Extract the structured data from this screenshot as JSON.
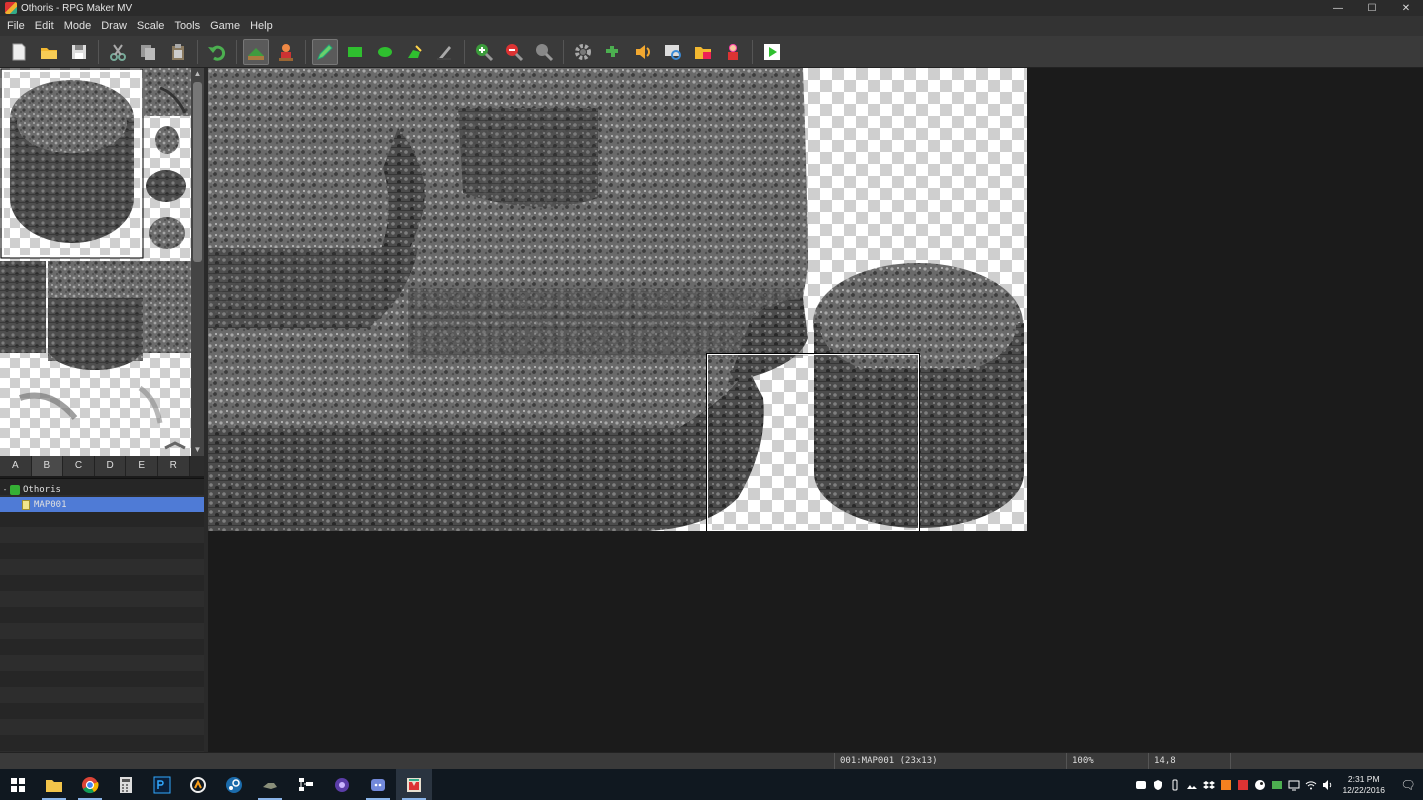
{
  "window": {
    "title": "Othoris - RPG Maker MV",
    "minimize": "—",
    "maximize": "☐",
    "close": "✕"
  },
  "menubar": {
    "items": [
      "File",
      "Edit",
      "Mode",
      "Draw",
      "Scale",
      "Tools",
      "Game",
      "Help"
    ]
  },
  "toolbar": {
    "buttons": [
      "new-project-icon",
      "open-project-icon",
      "save-project-icon",
      "cut-icon",
      "copy-icon",
      "paste-icon",
      "undo-icon",
      "map-mode-icon",
      "event-mode-icon",
      "pencil-icon",
      "rectangle-icon",
      "ellipse-icon",
      "flood-fill-icon",
      "shadow-pen-icon",
      "zoom-in-icon",
      "zoom-out-icon",
      "actual-size-icon",
      "database-icon",
      "plugin-manager-icon",
      "sound-test-icon",
      "event-searcher-icon",
      "resource-manager-icon",
      "character-generator-icon",
      "playtest-icon"
    ]
  },
  "tileset": {
    "tabs": [
      "A",
      "B",
      "C",
      "D",
      "E",
      "R"
    ],
    "active_tab": "B"
  },
  "map_tree": {
    "project": {
      "toggle": "-",
      "name": "Othoris"
    },
    "maps": [
      {
        "name": "MAP001"
      }
    ]
  },
  "statusbar": {
    "map": "001:MAP001 (23x13)",
    "zoom": "100%",
    "coords": "14,8"
  },
  "taskbar": {
    "apps": [
      "windows-start-icon",
      "file-explorer-icon",
      "chrome-icon",
      "calculator-icon",
      "photoshop-icon",
      "overwatch-icon",
      "steam-icon",
      "game-icon",
      "task-manager-icon",
      "app-icon",
      "discord-icon",
      "rpg-maker-icon"
    ],
    "clock_time": "2:31 PM",
    "clock_date": "12/22/2016",
    "notification": "🗨"
  },
  "colors": {
    "selection": "#4f7bd6",
    "background": "#1b1b1b",
    "panel": "#3a3a3a"
  }
}
